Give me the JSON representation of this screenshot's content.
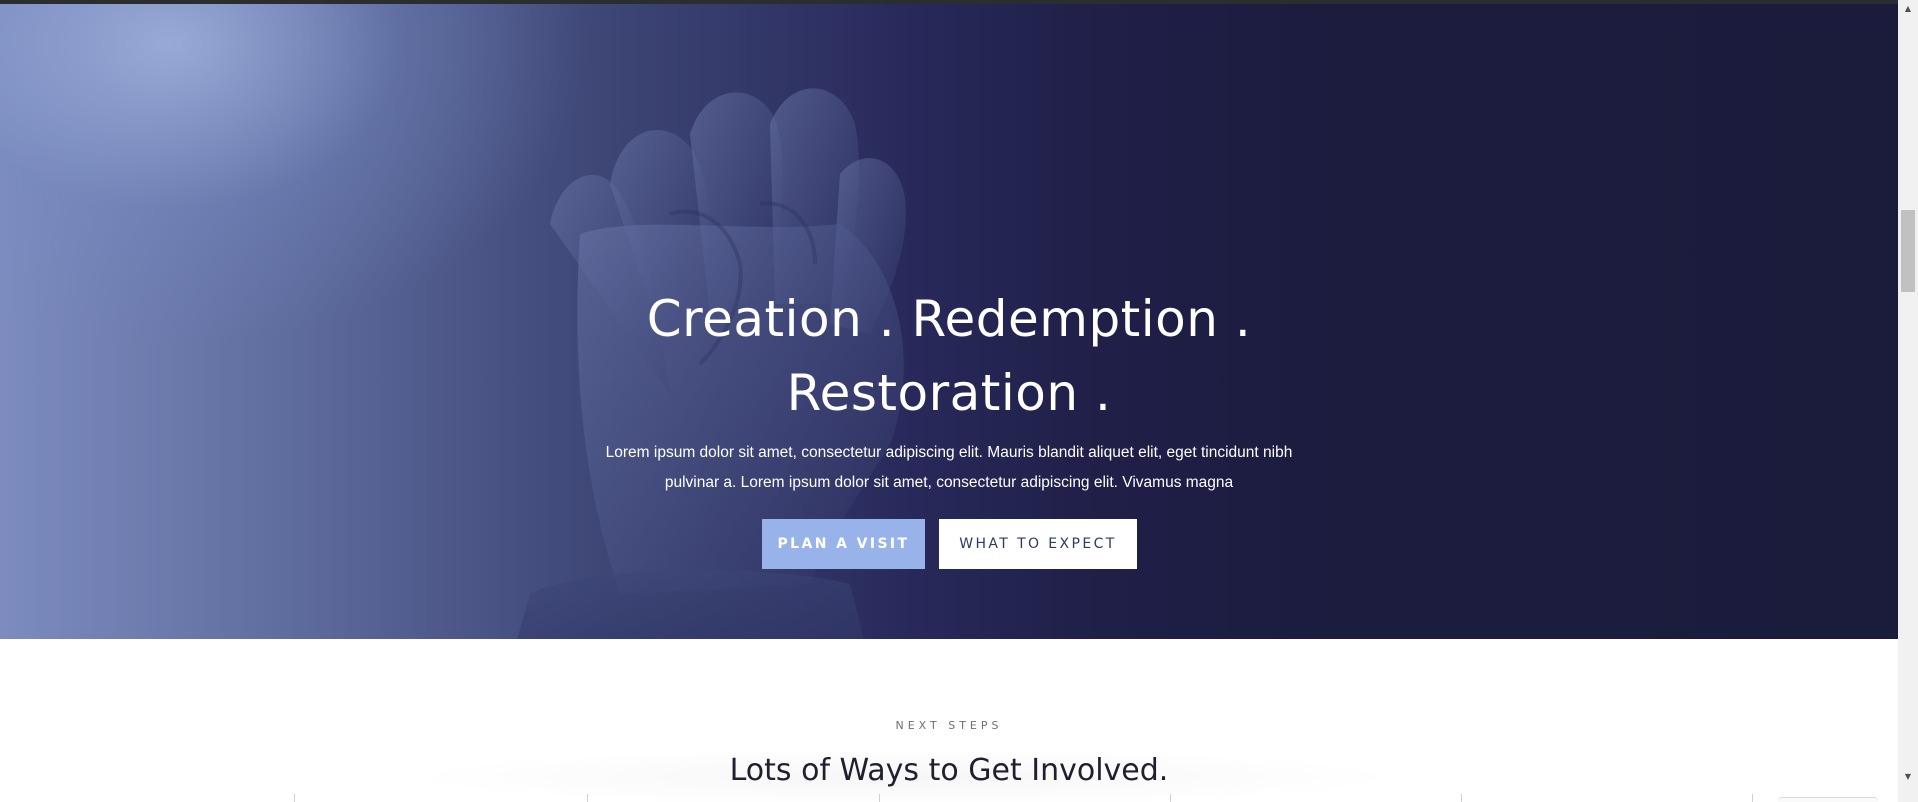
{
  "hero": {
    "title_line1": "Creation .  Redemption .",
    "title_line2": "Restoration .",
    "description_line1": "Lorem ipsum dolor sit amet, consectetur adipiscing elit. Mauris blandit aliquet elit, eget tincidunt nibh",
    "description_line2": "pulvinar a. Lorem ipsum dolor sit amet, consectetur adipiscing elit. Vivamus magna",
    "background_image": "praying-hands-photo",
    "buttons": {
      "plan_visit": "PLAN A VISIT",
      "what_to_expect": "WHAT TO EXPECT"
    }
  },
  "next_steps": {
    "eyebrow": "NEXT STEPS",
    "title": "Lots of Ways to Get  Involved."
  },
  "scrollbar": {
    "up_icon": "triangle-up-icon",
    "down_icon": "triangle-down-icon"
  },
  "colors": {
    "hero_dark": "#1c1c3d",
    "hero_light": "#7d8cbf",
    "accent_button": "#98b3ea",
    "button_text_dark": "#2e3a5e"
  }
}
